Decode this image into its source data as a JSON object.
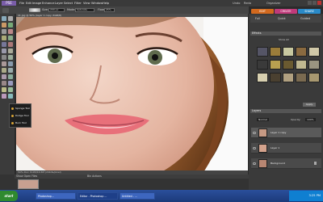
{
  "app": {
    "logo": "PSE",
    "menu": [
      "File",
      "Edit",
      "Image",
      "Enhance",
      "Layer",
      "Select",
      "Filter",
      "View",
      "Window",
      "Help"
    ],
    "right_links": [
      "Undo",
      "Redo",
      "Organizer"
    ]
  },
  "options_bar": {
    "size_label": "Size:",
    "size_value": "200 px",
    "mode_label": "Mode:",
    "mode_value": "Saturate",
    "flow_label": "Flow:",
    "flow_value": "25%"
  },
  "mode_tabs": [
    "EDIT",
    "CREATE",
    "SHARE"
  ],
  "mode_tab_colors": [
    "#d2691e",
    "#c03a7a",
    "#2a8ac8"
  ],
  "sub_tabs": [
    "Full",
    "Quick",
    "Guided"
  ],
  "document": {
    "title": "11.jpg @ 50% (layer 1 copy, RGB/8)",
    "status": "50%    Doc: 8.0M/16.5M (24bits/pixel)"
  },
  "tool_popup": {
    "items": [
      "Sponge Tool",
      "Dodge Tool",
      "Burn Tool"
    ]
  },
  "project_bin": {
    "label": "Show Open Files",
    "center_label": "Bin Actions"
  },
  "effects_panel": {
    "title": "Effects",
    "show_all": "Show All",
    "apply": "Apply"
  },
  "layers_panel": {
    "title": "Layers",
    "mode": "Normal",
    "opacity_label": "Opacity:",
    "opacity_value": "100%",
    "layers": [
      {
        "name": "Layer 1 copy",
        "selected": true
      },
      {
        "name": "Layer 1",
        "selected": false
      },
      {
        "name": "Background",
        "selected": false
      }
    ]
  },
  "taskbar": {
    "start": "start",
    "tasks": [
      "Photoshop...",
      "Editor - Photoshop ...",
      "Untitled - ..."
    ],
    "clock": "3:25 PM"
  }
}
